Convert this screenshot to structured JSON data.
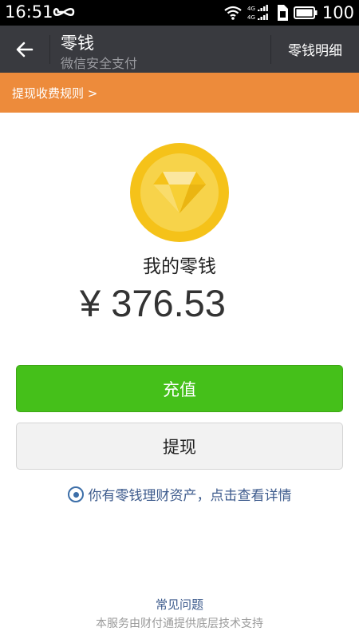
{
  "status_bar": {
    "time": "16:51",
    "battery": "100",
    "net_label_top": "4G",
    "net_label_bottom": "4G"
  },
  "title_bar": {
    "title": "零钱",
    "subtitle": "微信安全支付",
    "detail_label": "零钱明细"
  },
  "notice": {
    "text": "提现收费规则 >"
  },
  "balance": {
    "label": "我的零钱",
    "amount": "¥ 376.53"
  },
  "actions": {
    "recharge_label": "充值",
    "withdraw_label": "提现"
  },
  "finance": {
    "text": "你有零钱理财资产，点击查看详情"
  },
  "footer": {
    "faq_label": "常见问题",
    "note": "本服务由财付通提供底层技术支持"
  },
  "colors": {
    "status_bar": "#000000",
    "title_bar": "#393a3f",
    "notice_bar": "#ed8b3b",
    "coin_outer": "#f5c219",
    "coin_inner": "#f7d34a",
    "recharge_button": "#45c01a",
    "withdraw_button": "#f2f2f2",
    "link": "#3c5a8c"
  }
}
